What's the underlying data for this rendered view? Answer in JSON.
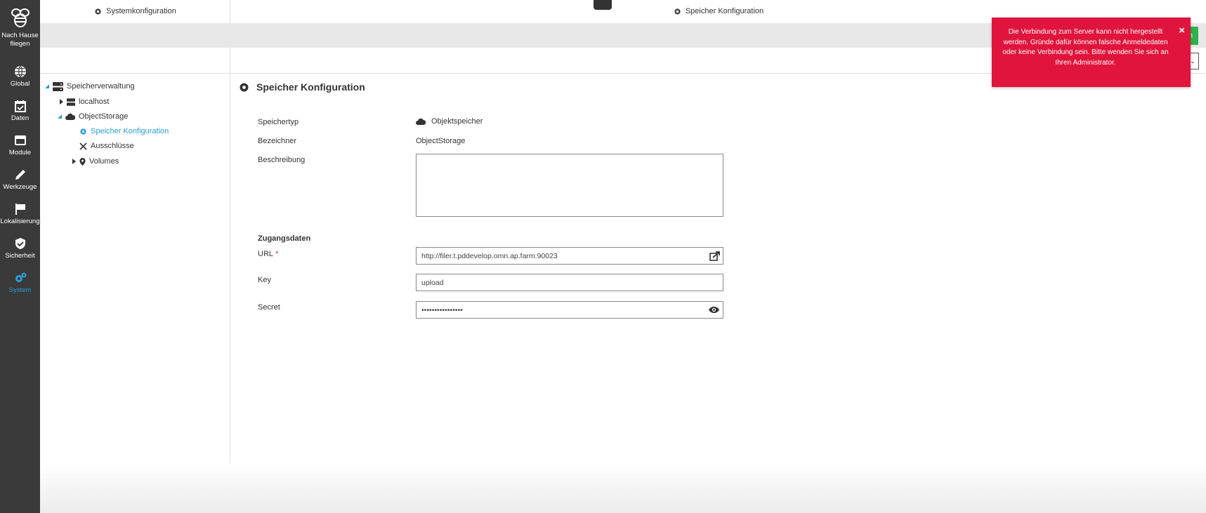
{
  "sidebar": {
    "logo_label": "Nach Hause fliegen",
    "items": [
      {
        "label": "Global",
        "icon": "globe-icon"
      },
      {
        "label": "Daten",
        "icon": "calendar-check-icon"
      },
      {
        "label": "Module",
        "icon": "window-icon"
      },
      {
        "label": "Werkzeuge",
        "icon": "pencil-icon"
      },
      {
        "label": "Lokalisierung",
        "icon": "flag-icon"
      },
      {
        "label": "Sicherheit",
        "icon": "shield-check-icon"
      },
      {
        "label": "System",
        "icon": "gears-icon",
        "active": true
      }
    ]
  },
  "header": {
    "left_title": "Systemkonfiguration",
    "right_title": "Speicher Konfiguration"
  },
  "tree": {
    "root": "Speicherverwaltung",
    "localhost": "localhost",
    "object_storage": "ObjectStorage",
    "speicher_konfiguration": "Speicher Konfiguration",
    "ausschluesse": "Ausschlüsse",
    "volumes": "Volumes"
  },
  "main": {
    "title": "Speicher Konfiguration",
    "speichertyp_label": "Speichertyp",
    "speichertyp_value": "Objektspeicher",
    "bezeichner_label": "Bezeichner",
    "bezeichner_value": "ObjectStorage",
    "beschreibung_label": "Beschreibung",
    "beschreibung_value": "",
    "zugangsdaten_heading": "Zugangsdaten",
    "url_label": "URL",
    "url_required": "*",
    "url_value": "http://filer.t.pddevelop.omn.ap.farm:90023",
    "key_label": "Key",
    "key_value": "upload",
    "secret_label": "Secret",
    "secret_value": "••••••••••••••••"
  },
  "toast": {
    "message": "Die Verbindung zum Server kann nicht hergestellt werden. Gründe dafür können falsche Anmeldedaten oder keine Verbindung sein. Bitte wenden Sie sich an Ihren Administrator.",
    "close": "×",
    "color": "#e0143c"
  },
  "partial_buttons": {
    "green_fragment": "n",
    "outline_fragment": "⌄"
  },
  "colors": {
    "accent": "#2a9fd6",
    "sidebar_bg": "#3a3a3a",
    "error": "#e0143c",
    "success": "#2eb34a"
  }
}
